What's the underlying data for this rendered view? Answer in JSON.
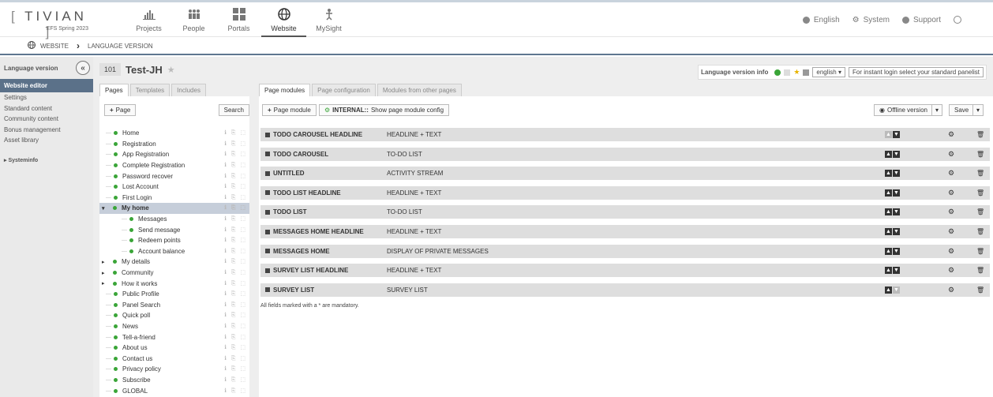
{
  "brand": {
    "logo": "TIVIAN",
    "version": "EFS Spring 2023"
  },
  "nav": [
    {
      "label": "Projects",
      "icon": "bar-chart-icon"
    },
    {
      "label": "People",
      "icon": "people-icon"
    },
    {
      "label": "Portals",
      "icon": "grid-icon"
    },
    {
      "label": "Website",
      "icon": "globe-icon",
      "active": true
    },
    {
      "label": "MySight",
      "icon": "mysight-icon"
    }
  ],
  "top_right": {
    "language": "English",
    "system": "System",
    "support": "Support"
  },
  "breadcrumb": {
    "root": "WEBSITE",
    "current": "LANGUAGE VERSION"
  },
  "sidebar": {
    "title": "Language version",
    "items": [
      "Website editor",
      "Settings",
      "Standard content",
      "Community content",
      "Bonus management",
      "Asset library"
    ],
    "systeminfo": "Systeminfo"
  },
  "page": {
    "number": "101",
    "name": "Test-JH"
  },
  "lang_info": {
    "label": "Language version info",
    "select": "english",
    "placeholder": "For instant login select your standard panelist"
  },
  "left_tabs": [
    "Pages",
    "Templates",
    "Includes"
  ],
  "left_buttons": {
    "add_page": "Page",
    "search": "Search"
  },
  "right_tabs": [
    "Page modules",
    "Page configuration",
    "Modules from other pages"
  ],
  "right_buttons": {
    "add_module": "Page module",
    "internal_bold": "INTERNAL::",
    "internal_text": "Show page module config",
    "offline": "Offline version",
    "save": "Save"
  },
  "tree": [
    {
      "label": "Home",
      "level": 0
    },
    {
      "label": "Registration",
      "level": 0
    },
    {
      "label": "App Registration",
      "level": 0
    },
    {
      "label": "Complete Registration",
      "level": 0
    },
    {
      "label": "Password recover",
      "level": 0
    },
    {
      "label": "Lost Account",
      "level": 0
    },
    {
      "label": "First Login",
      "level": 0
    },
    {
      "label": "My home",
      "level": 0,
      "selected": true,
      "expanded": true
    },
    {
      "label": "Messages",
      "level": 1
    },
    {
      "label": "Send message",
      "level": 1
    },
    {
      "label": "Redeem points",
      "level": 1
    },
    {
      "label": "Account balance",
      "level": 1
    },
    {
      "label": "My details",
      "level": 0,
      "collapsed": true
    },
    {
      "label": "Community",
      "level": 0,
      "collapsed": true
    },
    {
      "label": "How it works",
      "level": 0,
      "collapsed": true
    },
    {
      "label": "Public Profile",
      "level": 0
    },
    {
      "label": "Panel Search",
      "level": 0
    },
    {
      "label": "Quick poll",
      "level": 0
    },
    {
      "label": "News",
      "level": 0
    },
    {
      "label": "Tell-a-friend",
      "level": 0
    },
    {
      "label": "About us",
      "level": 0
    },
    {
      "label": "Contact us",
      "level": 0
    },
    {
      "label": "Privacy policy",
      "level": 0
    },
    {
      "label": "Subscribe",
      "level": 0
    },
    {
      "label": "GLOBAL",
      "level": 0
    }
  ],
  "modules": [
    {
      "name": "TODO CAROUSEL HEADLINE",
      "type": "HEADLINE + TEXT",
      "up": false,
      "down": true
    },
    {
      "name": "TODO CAROUSEL",
      "type": "TO-DO LIST",
      "up": true,
      "down": true
    },
    {
      "name": "UNTITLED",
      "type": "ACTIVITY STREAM",
      "up": true,
      "down": true
    },
    {
      "name": "TODO LIST HEADLINE",
      "type": "HEADLINE + TEXT",
      "up": true,
      "down": true
    },
    {
      "name": "TODO LIST",
      "type": "TO-DO LIST",
      "up": true,
      "down": true
    },
    {
      "name": "MESSAGES HOME HEADLINE",
      "type": "HEADLINE + TEXT",
      "up": true,
      "down": true
    },
    {
      "name": "MESSAGES HOME",
      "type": "DISPLAY OF PRIVATE MESSAGES",
      "up": true,
      "down": true
    },
    {
      "name": "SURVEY LIST HEADLINE",
      "type": "HEADLINE + TEXT",
      "up": true,
      "down": true
    },
    {
      "name": "SURVEY LIST",
      "type": "SURVEY LIST",
      "up": true,
      "down": false
    }
  ],
  "mandatory_note": "All fields marked with a * are mandatory."
}
